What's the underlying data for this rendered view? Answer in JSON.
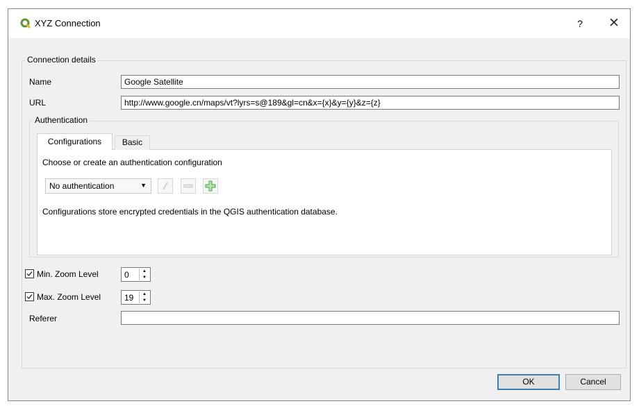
{
  "window": {
    "title": "XYZ Connection",
    "help_label": "?",
    "close_label": "✕"
  },
  "connection_details": {
    "group_title": "Connection details",
    "name_label": "Name",
    "name_value": "Google Satellite",
    "url_label": "URL",
    "url_value": "http://www.google.cn/maps/vt?lyrs=s@189&gl=cn&x={x}&y={y}&z={z}"
  },
  "authentication": {
    "group_title": "Authentication",
    "tabs": [
      {
        "label": "Configurations",
        "active": true
      },
      {
        "label": "Basic",
        "active": false
      }
    ],
    "instruction": "Choose or create an authentication configuration",
    "config_select_value": "No authentication",
    "info_text": "Configurations store encrypted credentials in the QGIS authentication database."
  },
  "zoom": {
    "min_label": "Min. Zoom Level",
    "min_value": "0",
    "min_checked": true,
    "max_label": "Max. Zoom Level",
    "max_value": "19",
    "max_checked": true
  },
  "referer": {
    "label": "Referer",
    "value": ""
  },
  "buttons": {
    "ok": "OK",
    "cancel": "Cancel"
  },
  "colors": {
    "qgis_green": "#589632",
    "add_green": "#3fa83f",
    "focus_blue": "#3c7fb1"
  }
}
